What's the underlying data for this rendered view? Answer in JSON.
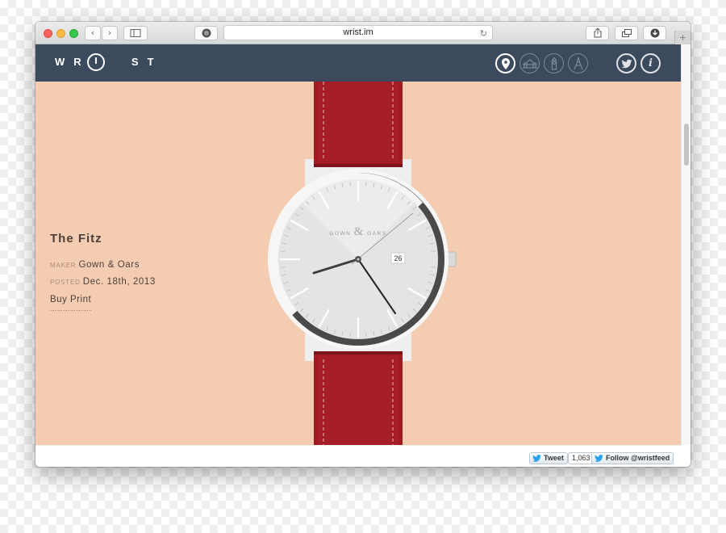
{
  "browser": {
    "url": "wrist.im",
    "reload_glyph": "↻",
    "new_tab_glyph": "+",
    "back_glyph": "‹",
    "forward_glyph": "›"
  },
  "site": {
    "logo_left": "WR",
    "logo_right": "ST",
    "nav_icons": [
      "location-pin-icon",
      "bridge-icon",
      "big-ben-icon",
      "eiffel-tower-icon"
    ],
    "social_icons": [
      "twitter-icon",
      "info-icon"
    ],
    "info_glyph": "i"
  },
  "watch": {
    "name": "The Fitz",
    "maker_label": "MAKER",
    "maker": "Gown & Oars",
    "posted_label": "POSTED",
    "posted": "Dec. 18th, 2013",
    "buy_label": "Buy Print",
    "dial_brand_left": "GOWN",
    "dial_brand_mid": "&",
    "dial_brand_right": "OARS",
    "date": "26",
    "strap_color": "#9e1b22",
    "background_color": "#f4ccb2"
  },
  "footer": {
    "tweet_label": "Tweet",
    "tweet_count": "1,063",
    "follow_label": "Follow @wristfeed"
  },
  "colors": {
    "nav_bar": "#3c4a5e"
  }
}
